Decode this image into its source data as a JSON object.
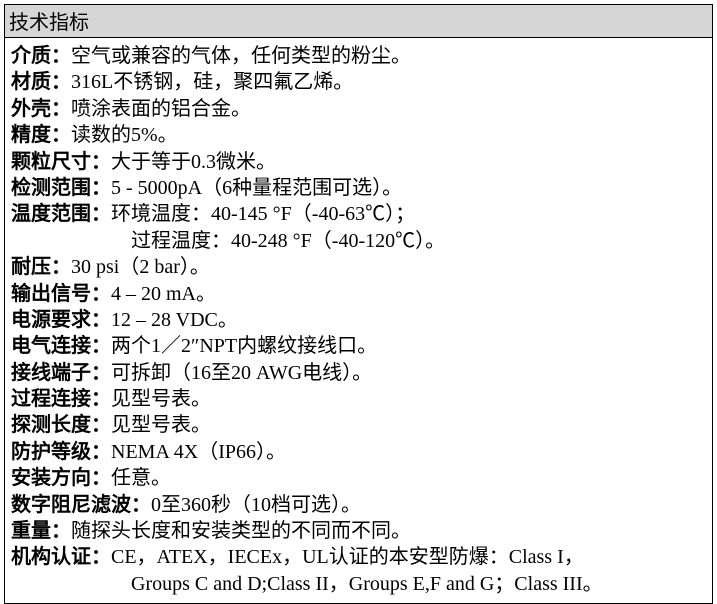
{
  "title": "技术指标",
  "rows": [
    {
      "label": "介质：",
      "value": "空气或兼容的气体，任何类型的粉尘。"
    },
    {
      "label": "材质：",
      "value": "316L不锈钢，硅，聚四氟乙烯。"
    },
    {
      "label": "外壳：",
      "value": "喷涂表面的铝合金。"
    },
    {
      "label": "精度：",
      "value": "读数的5%。"
    },
    {
      "label": "颗粒尺寸：",
      "value": "大于等于0.3微米。"
    },
    {
      "label": "检测范围：",
      "value": "5 - 5000pA（6种量程范围可选）。"
    },
    {
      "label": "温度范围：",
      "value": "环境温度：40-145 °F（-40-63℃）；"
    },
    {
      "label": "",
      "value": "过程温度：40-248 °F（-40-120℃）。",
      "indent": true
    },
    {
      "label": "耐压：",
      "value": "30 psi（2 bar）。"
    },
    {
      "label": "输出信号：",
      "value": "4 – 20 mA。"
    },
    {
      "label": "电源要求：",
      "value": "12 – 28 VDC。"
    },
    {
      "label": "电气连接：",
      "value": "两个1／2″NPT内螺纹接线口。"
    },
    {
      "label": "接线端子：",
      "value": "可拆卸（16至20 AWG电线）。"
    },
    {
      "label": "过程连接：",
      "value": "见型号表。"
    },
    {
      "label": "探测长度：",
      "value": "见型号表。"
    },
    {
      "label": "防护等级：",
      "value": "NEMA 4X（IP66）。"
    },
    {
      "label": "安装方向：",
      "value": "任意。"
    },
    {
      "label": "数字阻尼滤波：",
      "value": "0至360秒（10档可选）。"
    },
    {
      "label": "重量：",
      "value": "随探头长度和安装类型的不同而不同。"
    },
    {
      "label": "机构认证：",
      "value": "CE，ATEX，IECEx，UL认证的本安型防爆：Class I，"
    },
    {
      "label": "",
      "value": "Groups C and D;Class II，Groups E,F and G；Class III。",
      "indent": true
    }
  ]
}
